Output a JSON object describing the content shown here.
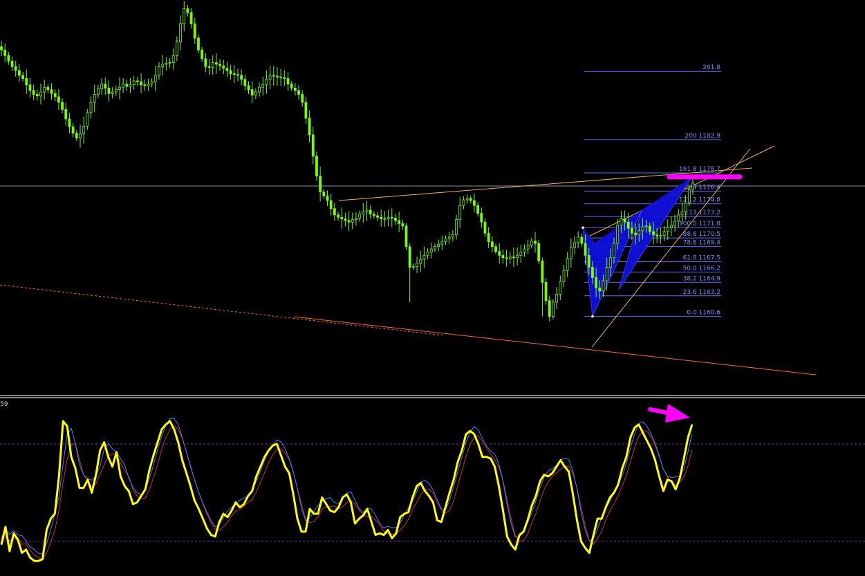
{
  "chart_data": [
    {
      "type": "candlestick",
      "name": "price-panel",
      "title": "",
      "colors": {
        "candle": "#7CFC00",
        "pattern_fill": "#1010dd",
        "fib_line": "#5a6cff",
        "trendline": "#f0b050",
        "channel_line": "#ff6a2a",
        "target_marker": "#ff00ff"
      },
      "ylim": [
        1150.8,
        1200.5
      ],
      "fib_levels": [
        {
          "pct": "261.8",
          "price": "",
          "label": "261.8",
          "y": 1191.5
        },
        {
          "pct": "200",
          "price": "1182.9",
          "label": "200 1182.9",
          "y": 1182.9
        },
        {
          "pct": "161.8",
          "price": "1178.7",
          "label": "161.8 1178.7",
          "y": 1178.7
        },
        {
          "pct": "141.4",
          "price": "1176.4",
          "label": "141.4 1176.4",
          "y": 1176.4
        },
        {
          "pct": "127.2",
          "price": "1174.8",
          "label": "127.2 1174.8",
          "y": 1174.8
        },
        {
          "pct": "113",
          "price": "1173.2",
          "label": "113 1173.2",
          "y": 1173.2
        },
        {
          "pct": "100.0",
          "price": "1171.8",
          "label": "100.0 1171.8",
          "y": 1171.8
        },
        {
          "pct": "88.6",
          "price": "1170.5",
          "label": "88.6 1170.5",
          "y": 1170.5
        },
        {
          "pct": "78.6",
          "price": "1169.4",
          "label": "78.6 1169.4",
          "y": 1169.4
        },
        {
          "pct": "61.8",
          "price": "1167.5",
          "label": "61.8 1167.5",
          "y": 1167.5
        },
        {
          "pct": "50.0",
          "price": "1166.2",
          "label": "50.0 1166.2",
          "y": 1166.2
        },
        {
          "pct": "38.2",
          "price": "1164.9",
          "label": "38.2 1164.9",
          "y": 1164.9
        },
        {
          "pct": "23.6",
          "price": "1163.2",
          "label": "23.6 1163.2",
          "y": 1163.2
        },
        {
          "pct": "0.0",
          "price": "1160.6",
          "label": "0.0 1160.6",
          "y": 1160.6
        }
      ],
      "series": [
        {
          "name": "",
          "type": "close",
          "values": [
            1194.2,
            1193.5,
            1192.8,
            1192.1,
            1191.6,
            1191.0,
            1190.6,
            1189.8,
            1189.1,
            1188.6,
            1188.4,
            1188.9,
            1189.5,
            1189.2,
            1188.7,
            1188.3,
            1187.6,
            1186.7,
            1185.5,
            1184.5,
            1183.7,
            1183.1,
            1183.6,
            1184.6,
            1186.3,
            1187.6,
            1188.6,
            1189.3,
            1189.9,
            1189.4,
            1188.7,
            1188.9,
            1189.2,
            1189.5,
            1189.9,
            1189.6,
            1189.8,
            1190.3,
            1190.2,
            1189.8,
            1189.7,
            1189.9,
            1190.2,
            1191.0,
            1192.1,
            1192.4,
            1192.5,
            1192.6,
            1193.5,
            1195.2,
            1197.5,
            1199.4,
            1198.9,
            1197.5,
            1195.7,
            1194.2,
            1193.1,
            1192.1,
            1192.0,
            1192.6,
            1192.4,
            1192.2,
            1191.9,
            1191.6,
            1191.2,
            1191.1,
            1191.0,
            1190.5,
            1189.7,
            1189.2,
            1188.5,
            1188.9,
            1189.5,
            1189.8,
            1190.5,
            1191.0,
            1190.9,
            1190.8,
            1190.7,
            1190.6,
            1189.9,
            1189.4,
            1189.1,
            1188.6,
            1187.6,
            1185.6,
            1183.5,
            1180.8,
            1178.3,
            1176.3,
            1175.8,
            1175.2,
            1174.2,
            1173.4,
            1173.1,
            1172.9,
            1172.7,
            1172.5,
            1172.8,
            1173.0,
            1173.5,
            1173.8,
            1174.0,
            1173.5,
            1173.3,
            1173.1,
            1172.9,
            1172.9,
            1173.1,
            1173.0,
            1172.7,
            1172.3,
            1172.0,
            1169.4,
            1166.8,
            1166.9,
            1167.3,
            1167.8,
            1168.3,
            1168.7,
            1169.1,
            1169.4,
            1169.7,
            1170.0,
            1170.4,
            1170.6,
            1170.9,
            1172.8,
            1174.6,
            1175.3,
            1175.5,
            1175.2,
            1174.6,
            1173.6,
            1172.5,
            1171.1,
            1170.0,
            1169.4,
            1168.8,
            1168.3,
            1168.0,
            1167.9,
            1168.1,
            1168.0,
            1168.3,
            1168.7,
            1169.1,
            1169.6,
            1170.1,
            1169.8,
            1167.6,
            1164.9,
            1162.6,
            1160.6,
            1162.4,
            1163.4,
            1165.0,
            1166.4,
            1167.9,
            1169.3,
            1169.9,
            1170.6,
            1169.8,
            1168.3,
            1166.8,
            1165.5,
            1164.2,
            1163.8,
            1165.1,
            1166.8,
            1168.0,
            1169.8,
            1172.1,
            1172.9,
            1172.5,
            1171.7,
            1171.1,
            1170.9,
            1171.4,
            1171.9,
            1172.0,
            1171.3,
            1170.9,
            1170.7,
            1170.8,
            1171.3,
            1171.8,
            1172.1,
            1172.6,
            1173.4,
            1173.8,
            1174.9,
            1176.6,
            1177.4
          ]
        }
      ],
      "annotations": [
        "blue harmonic pattern",
        "magenta target bar at 161.8 level",
        "converging trendlines"
      ]
    },
    {
      "type": "line",
      "name": "oscillator-panel",
      "title": "",
      "label": "59",
      "ylim": [
        0,
        100
      ],
      "levels": [
        20,
        80
      ],
      "colors": {
        "main": "#ffff00",
        "signal_blue": "#4a7cff",
        "signal_red": "#d03030",
        "level_line": "#7a2aa0",
        "arrow": "#ff00ff"
      },
      "series": [
        {
          "name": "",
          "color": "#ffff00",
          "values": [
            18,
            29,
            14,
            25,
            21,
            13,
            15,
            10,
            8,
            8,
            9,
            27,
            34,
            37,
            60,
            94,
            91,
            72,
            65,
            53,
            53,
            58,
            50,
            61,
            76,
            81,
            72,
            66,
            75,
            60,
            54,
            51,
            43,
            44,
            48,
            52,
            64,
            73,
            81,
            89,
            92,
            94,
            89,
            81,
            70,
            62,
            54,
            45,
            40,
            34,
            28,
            24,
            23,
            32,
            37,
            35,
            39,
            44,
            41,
            43,
            48,
            51,
            60,
            66,
            72,
            76,
            79,
            80,
            73,
            66,
            62,
            49,
            34,
            26,
            26,
            40,
            37,
            37,
            47,
            43,
            39,
            38,
            41,
            47,
            49,
            44,
            31,
            34,
            36,
            40,
            32,
            24,
            25,
            24,
            27,
            22,
            25,
            35,
            37,
            38,
            47,
            54,
            56,
            51,
            48,
            44,
            33,
            32,
            41,
            50,
            58,
            69,
            76,
            86,
            88,
            86,
            80,
            72,
            72,
            71,
            66,
            54,
            39,
            23,
            18,
            15,
            24,
            26,
            33,
            42,
            48,
            57,
            61,
            60,
            62,
            66,
            70,
            66,
            63,
            49,
            33,
            20,
            16,
            13,
            24,
            34,
            34,
            41,
            47,
            50,
            55,
            65,
            72,
            84,
            90,
            92,
            87,
            82,
            77,
            70,
            60,
            51,
            58,
            57,
            52,
            59,
            71,
            84,
            92
          ]
        }
      ],
      "annotations": [
        "magenta arrow pointing down-right at oscillator top"
      ]
    }
  ]
}
